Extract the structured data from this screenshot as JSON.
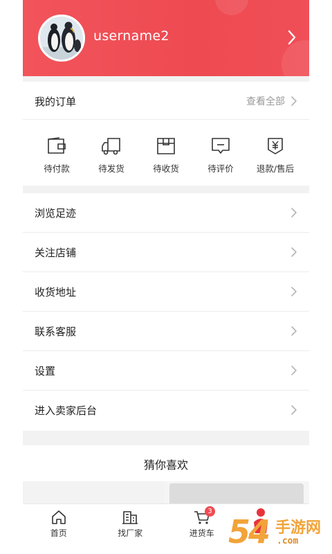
{
  "header": {
    "username": "username2",
    "accent_color": "#ef4f56"
  },
  "orders": {
    "title": "我的订单",
    "view_all_label": "查看全部",
    "items": [
      {
        "label": "待付款",
        "icon": "wallet-icon"
      },
      {
        "label": "待发货",
        "icon": "truck-icon"
      },
      {
        "label": "待收货",
        "icon": "package-icon"
      },
      {
        "label": "待评价",
        "icon": "comment-icon"
      },
      {
        "label": "退款/售后",
        "icon": "refund-icon"
      }
    ]
  },
  "menu": {
    "items": [
      {
        "label": "浏览足迹"
      },
      {
        "label": "关注店铺"
      },
      {
        "label": "收货地址"
      },
      {
        "label": "联系客服"
      },
      {
        "label": "设置"
      },
      {
        "label": "进入卖家后台"
      }
    ]
  },
  "recommend": {
    "title": "猜你喜欢"
  },
  "tabbar": {
    "items": [
      {
        "label": "首页",
        "icon": "home-icon"
      },
      {
        "label": "找厂家",
        "icon": "factory-icon"
      },
      {
        "label": "进货车",
        "icon": "cart-icon",
        "badge": "3"
      },
      {
        "label": "",
        "icon": "user-icon"
      }
    ]
  },
  "watermark": {
    "digits": "54",
    "text": "手游网",
    "url": ".com"
  }
}
